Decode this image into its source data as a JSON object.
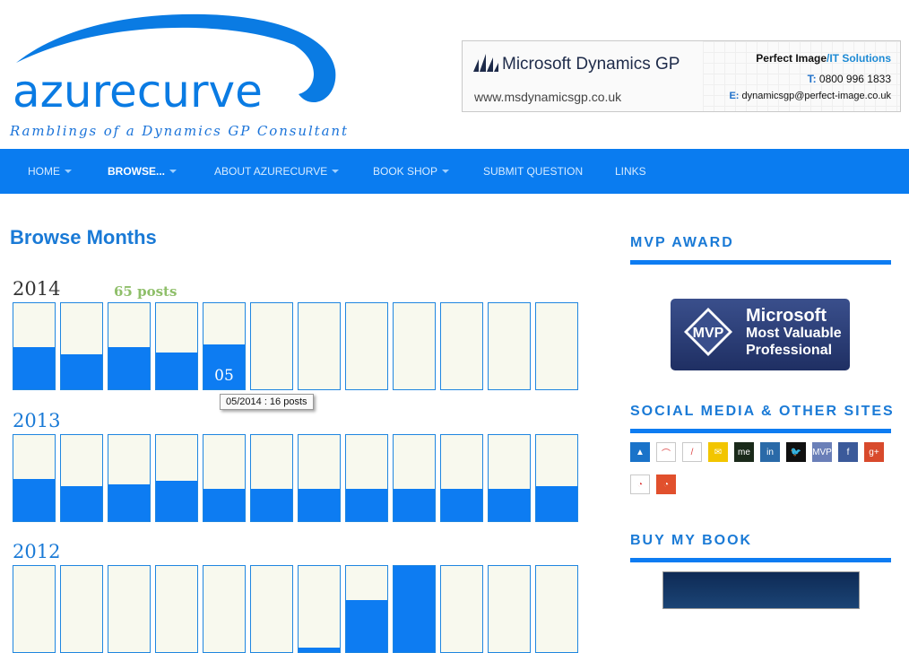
{
  "site": {
    "logo_text": "azurecurve",
    "tagline": "Ramblings of a Dynamics GP Consultant"
  },
  "banner": {
    "product": "Microsoft Dynamics GP",
    "url": "www.msdynamicsgp.co.uk",
    "company": "Perfect Image",
    "company_suffix": "/IT Solutions",
    "tel_label": "T:",
    "tel": "0800 996 1833",
    "email_label": "E:",
    "email": "dynamicsgp@perfect-image.co.uk"
  },
  "nav": {
    "items": [
      {
        "label": "HOME",
        "caret": true
      },
      {
        "label": "BROWSE...",
        "caret": true,
        "active": true
      },
      {
        "label": "ABOUT AZURECURVE",
        "caret": true
      },
      {
        "label": "BOOK SHOP",
        "caret": true
      },
      {
        "label": "SUBMIT QUESTION",
        "caret": false
      },
      {
        "label": "LINKS",
        "caret": false
      }
    ]
  },
  "main": {
    "title": "Browse Months",
    "years": [
      {
        "year": "2014",
        "posts": "65 posts",
        "month_fill_fraction": [
          0.49,
          0.41,
          0.49,
          0.43,
          0.52,
          0,
          0,
          0,
          0,
          0,
          0,
          0
        ],
        "hovered_month_label": "05",
        "tooltip": "05/2014 : 16 posts"
      },
      {
        "year": "2013",
        "month_fill_fraction": [
          0.49,
          0.41,
          0.43,
          0.47,
          0.38,
          0.38,
          0.38,
          0.38,
          0.38,
          0.38,
          0.38,
          0.41
        ]
      },
      {
        "year": "2012",
        "month_fill_fraction": [
          0,
          0,
          0,
          0,
          0,
          0,
          0.05,
          0.6,
          1.0,
          0,
          0,
          0
        ]
      }
    ],
    "colors": {
      "fill": "#0d7cf2",
      "empty": "#f8f9ee",
      "year_2014": "#333333",
      "year_other": "#1a7ad6",
      "posts": "#8fbf6a"
    }
  },
  "sidebar": {
    "mvp_heading": "MVP AWARD",
    "mvp_badge": {
      "mvp": "MVP",
      "line1": "Microsoft",
      "line2": "Most Valuable",
      "line3": "Professional"
    },
    "social_heading": "SOCIAL MEDIA & OTHER SITES",
    "social_icons": [
      {
        "name": "dynamics-gp-icon",
        "glyph": "▲",
        "bg": "#1a73c9"
      },
      {
        "name": "azurecurve-icon",
        "glyph": "⌒",
        "bg": "#ffffff"
      },
      {
        "name": "slash-icon",
        "glyph": "/",
        "bg": "#ffffff"
      },
      {
        "name": "email-icon",
        "glyph": "✉",
        "bg": "#f2c500"
      },
      {
        "name": "about-me-icon",
        "glyph": "me",
        "bg": "#1a2a1a"
      },
      {
        "name": "linkedin-icon",
        "glyph": "in",
        "bg": "#2a6aa8"
      },
      {
        "name": "twitter-icon",
        "glyph": "🐦",
        "bg": "#101010"
      },
      {
        "name": "mvp-icon",
        "glyph": "MVP",
        "bg": "#6a7fb8"
      },
      {
        "name": "facebook-icon",
        "glyph": "f",
        "bg": "#3b5a9a"
      },
      {
        "name": "google-plus-icon",
        "glyph": "g+",
        "bg": "#d84a2c"
      },
      {
        "name": "rss-icon",
        "glyph": "◔",
        "bg": "#ffffff"
      },
      {
        "name": "rss-feed-icon",
        "glyph": "◔",
        "bg": "#e1502d"
      }
    ],
    "book_heading": "BUY MY BOOK"
  }
}
